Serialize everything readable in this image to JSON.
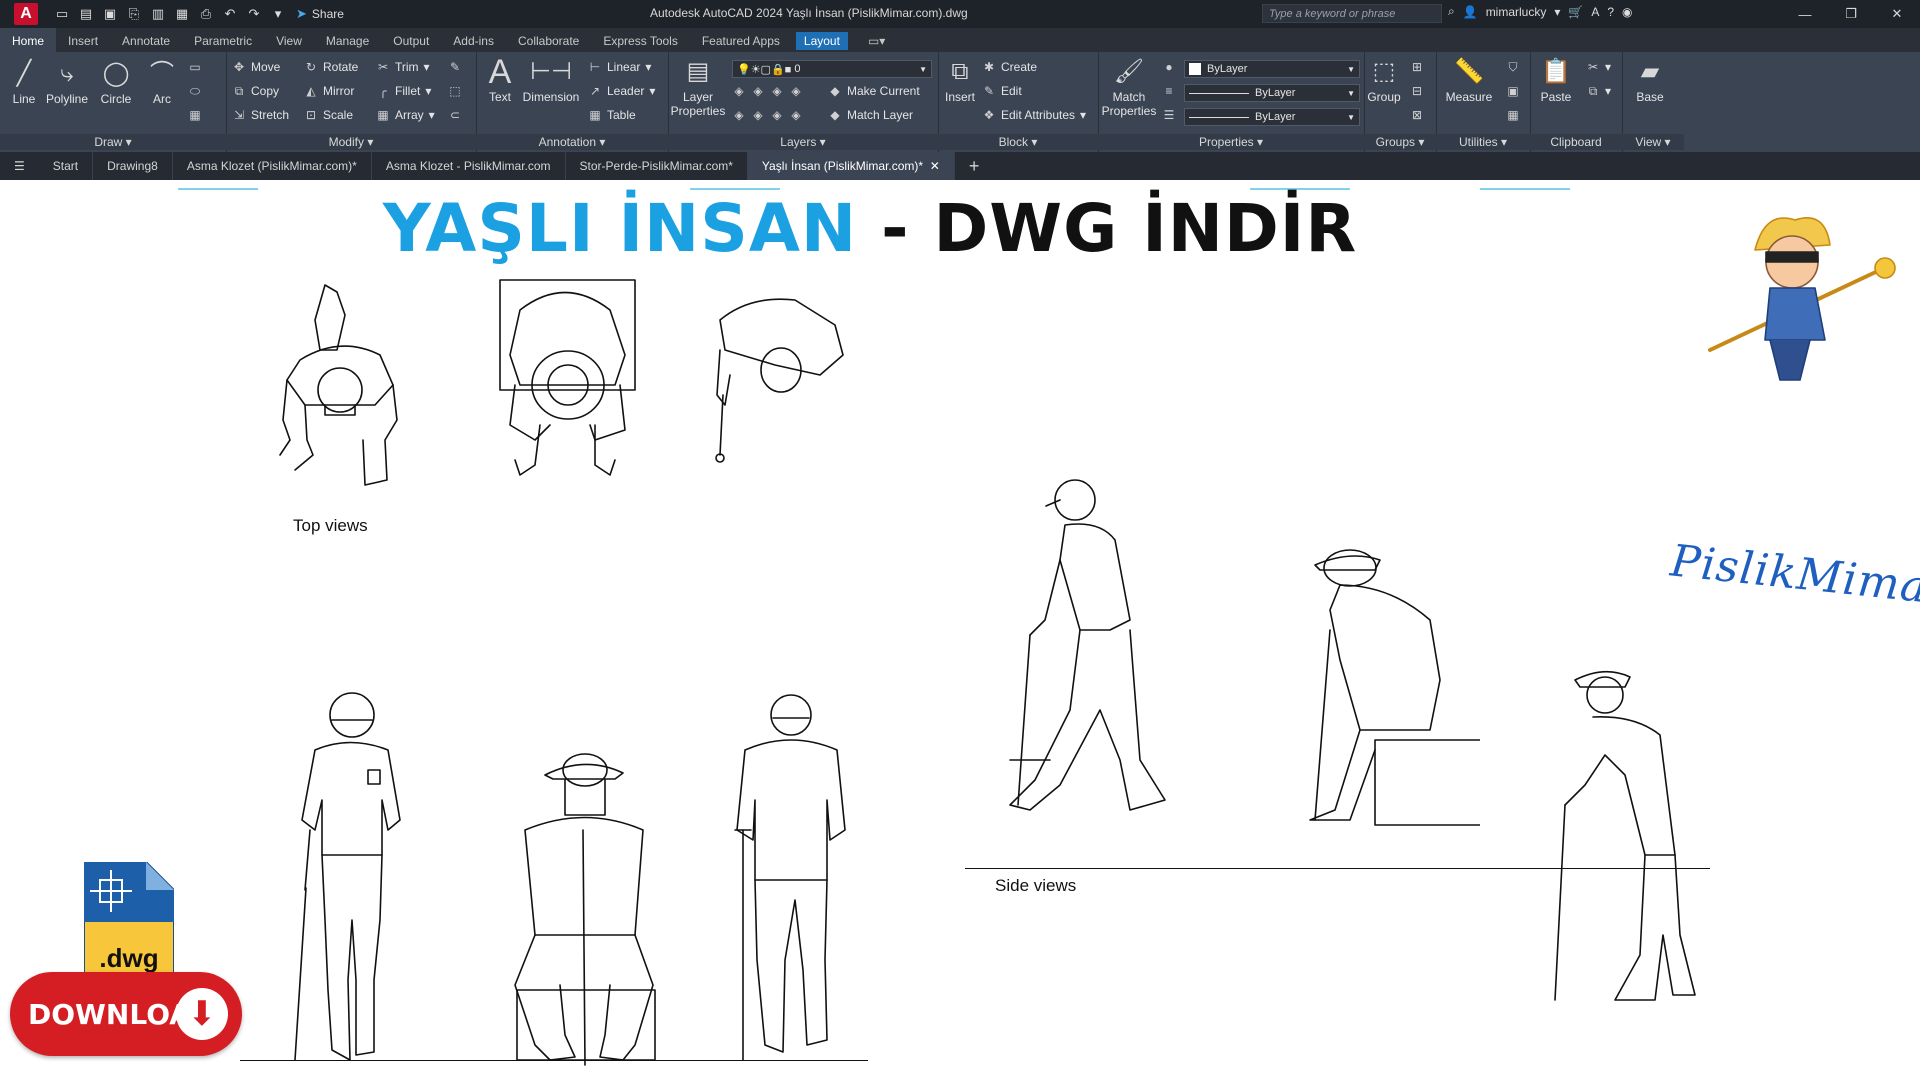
{
  "app": {
    "logo_letter": "A",
    "title": "Autodesk AutoCAD 2024   Yaşlı İnsan (PislikMimar.com).dwg",
    "share_label": "Share",
    "search_placeholder": "Type a keyword or phrase",
    "user": "mimarlucky"
  },
  "ribbon_tabs": [
    "Home",
    "Insert",
    "Annotate",
    "Parametric",
    "View",
    "Manage",
    "Output",
    "Add-ins",
    "Collaborate",
    "Express Tools",
    "Featured Apps",
    "Layout"
  ],
  "draw": {
    "label": "Draw",
    "line": "Line",
    "polyline": "Polyline",
    "circle": "Circle",
    "arc": "Arc"
  },
  "modify": {
    "label": "Modify",
    "move": "Move",
    "rotate": "Rotate",
    "trim": "Trim",
    "copy": "Copy",
    "mirror": "Mirror",
    "fillet": "Fillet",
    "stretch": "Stretch",
    "scale": "Scale",
    "array": "Array"
  },
  "annotation": {
    "label": "Annotation",
    "text": "Text",
    "dimension": "Dimension",
    "linear": "Linear",
    "leader": "Leader",
    "table": "Table"
  },
  "layers": {
    "label": "Layers",
    "layer_properties": "Layer Properties",
    "current_layer": "0",
    "make_current": "Make Current",
    "match_layer": "Match Layer"
  },
  "block": {
    "label": "Block",
    "insert": "Insert",
    "create": "Create",
    "edit": "Edit",
    "edit_attributes": "Edit Attributes"
  },
  "properties": {
    "label": "Properties",
    "match_properties": "Match Properties",
    "color": "ByLayer",
    "linetype": "ByLayer",
    "lineweight": "ByLayer"
  },
  "groups": {
    "label": "Groups",
    "group": "Group"
  },
  "utilities": {
    "label": "Utilities",
    "measure": "Measure"
  },
  "clipboard": {
    "label": "Clipboard",
    "paste": "Paste"
  },
  "view": {
    "label": "View",
    "base": "Base"
  },
  "doc_tabs": [
    "Start",
    "Drawing8",
    "Asma Klozet (PislikMimar.com)*",
    "Asma Klozet - PislikMimar.com",
    "Stor-Perde-PislikMimar.com*",
    "Yaşlı İnsan (PislikMimar.com)*"
  ],
  "drawing": {
    "heading_blue": "YAŞLI İNSAN",
    "heading_black": " - DWG İNDİR",
    "top_views_label": "Top views",
    "side_views_label": "Side views",
    "dwg_ext": ".dwg",
    "download_label": "DOWNLOAD",
    "brand": "PislikMimar"
  },
  "colors": {
    "accent_blue": "#1ba1e2",
    "download_red": "#d41e24",
    "ribbon_bg": "#3b4453"
  }
}
